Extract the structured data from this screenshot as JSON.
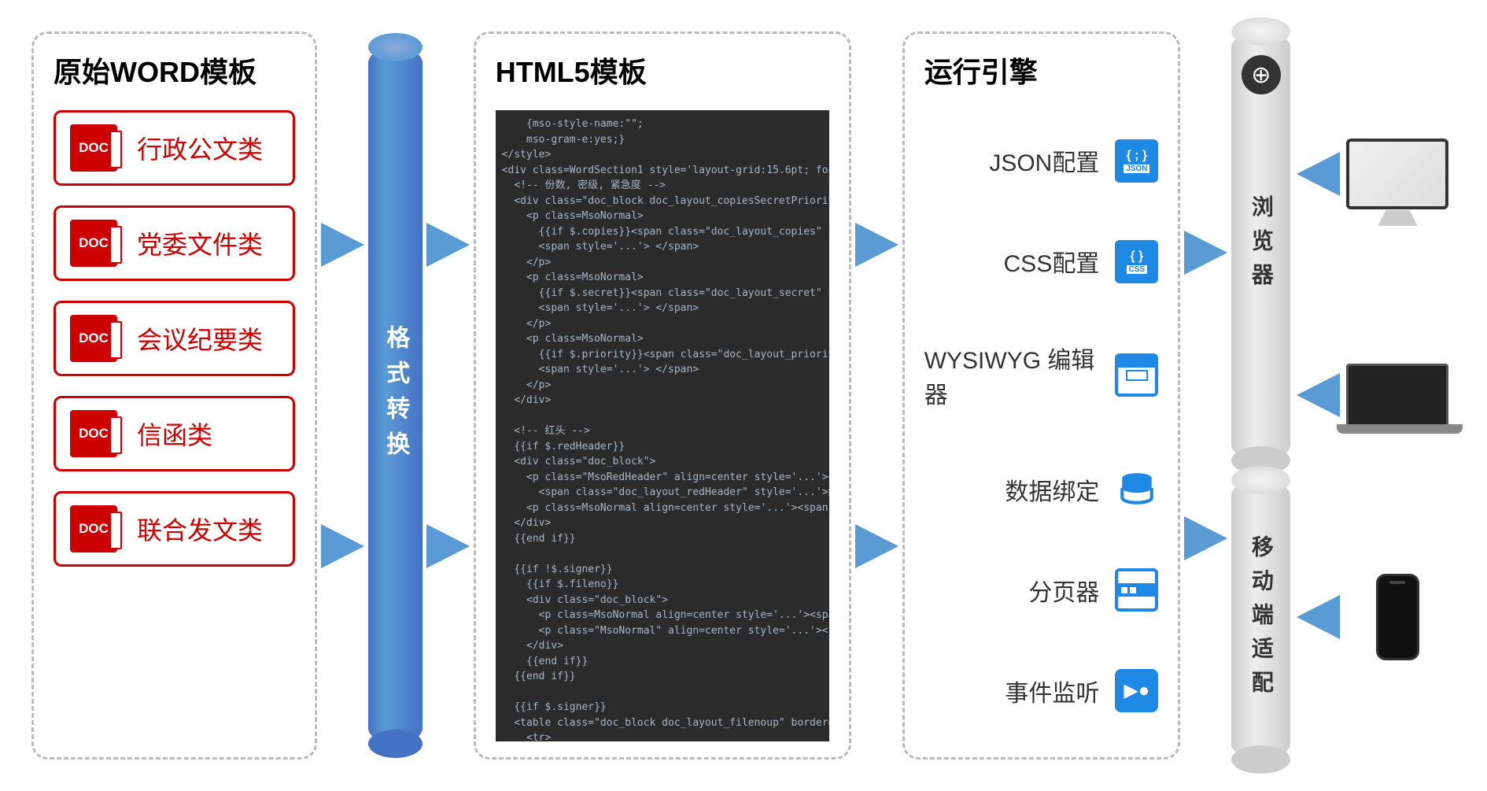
{
  "panel1": {
    "title": "原始WORD模板",
    "items": [
      "行政公文类",
      "党委文件类",
      "会议纪要类",
      "信函类",
      "联合发文类"
    ],
    "icon_label": "DOC"
  },
  "converter_label": "格式转换",
  "panel2": {
    "title": "HTML5模板",
    "code": "    {mso-style-name:\"\";\n    mso-gram-e:yes;}\n</style>\n<div class=WordSection1 style='layout-grid:15.6pt; font-size\n  <!-- 份数, 密级, 紧急度 -->\n  <div class=\"doc_block doc_layout_copiesSecretPriority\">\n    <p class=MsoNormal>\n      {{if $.copies}}<span class=\"doc_layout_copies\" s\n      <span style='...'> </span>\n    </p>\n    <p class=MsoNormal>\n      {{if $.secret}}<span class=\"doc_layout_secret\" st\n      <span style='...'> </span>\n    </p>\n    <p class=MsoNormal>\n      {{if $.priority}}<span class=\"doc_layout_priority\n      <span style='...'> </span>\n    </p>\n  </div>\n\n  <!-- 红头 -->\n  {{if $.redHeader}}\n  <div class=\"doc_block\">\n    <p class=\"MsoRedHeader\" align=center style='...'><b>\n      <span class=\"doc_layout_redHeader\" style='...'>红\n    <p class=MsoNormal align=center style='...'><span sty\n  </div>\n  {{end if}}\n\n  {{if !$.signer}}\n    {{if $.fileno}}\n    <div class=\"doc_block\">\n      <p class=MsoNormal align=center style='...'><spa\n      <p class=\"MsoNormal\" align=center style='...'><spa\n    </div>\n    {{end if}}\n  {{end if}}\n\n  {{if $.signer}}\n  <table class=\"doc_block doc_layout_filenoup\" border=0 ce\n    <tr>"
  },
  "panel3": {
    "title": "运行引擎",
    "items": [
      {
        "label": "JSON配置",
        "icon": "json"
      },
      {
        "label": "CSS配置",
        "icon": "css"
      },
      {
        "label": "WYSIWYG 编辑器",
        "icon": "editor"
      },
      {
        "label": "数据绑定",
        "icon": "database"
      },
      {
        "label": "分页器",
        "icon": "pager"
      },
      {
        "label": "事件监听",
        "icon": "event"
      }
    ]
  },
  "outputs": {
    "browser": "浏览器",
    "mobile": "移动端适配"
  }
}
